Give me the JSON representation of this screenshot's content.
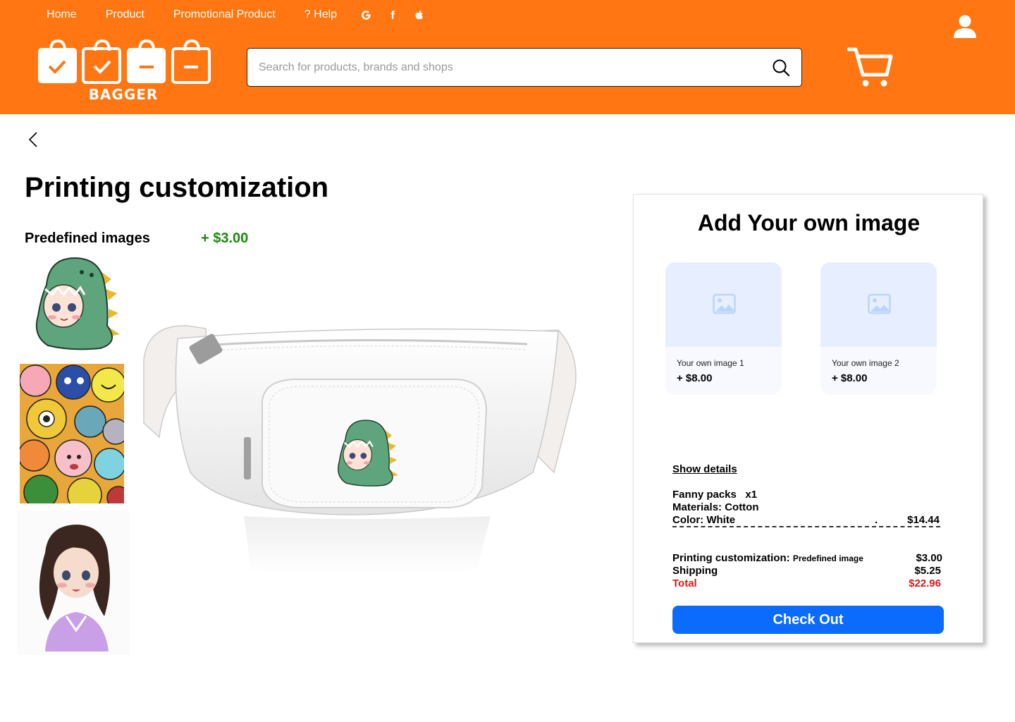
{
  "nav": {
    "home": "Home",
    "product": "Product",
    "promotional": "Promotional Product",
    "help": "? Help",
    "social": [
      "google-icon",
      "facebook-icon",
      "apple-icon"
    ]
  },
  "brand": {
    "name": "BAGGER"
  },
  "search": {
    "placeholder": "Search for products, brands and shops",
    "value": ""
  },
  "page": {
    "title": "Printing customization",
    "predefined_label": "Predefined images",
    "predefined_price": "+ $3.00"
  },
  "panel": {
    "title": "Add Your own image",
    "uploads": [
      {
        "label": "Your own image 1",
        "price": "+ $8.00"
      },
      {
        "label": "Your own image 2",
        "price": "+ $8.00"
      }
    ],
    "show_details": "Show details",
    "item_line": "Fanny packs   x1",
    "materials": "Materials: Cotton",
    "color": "Color: White",
    "dot": ".",
    "item_price": "$14.44",
    "printing_label": "Printing customization:",
    "printing_note": "Predefined image",
    "printing_price": "$3.00",
    "shipping_label": "Shipping",
    "shipping_price": "$5.25",
    "total_label": "Total",
    "total_price": "$22.96",
    "checkout": "Check Out"
  },
  "colors": {
    "header": "#ff7612",
    "accent_blue": "#0a6bfc",
    "price_green": "#1d8a0d",
    "total_red": "#e01616"
  }
}
